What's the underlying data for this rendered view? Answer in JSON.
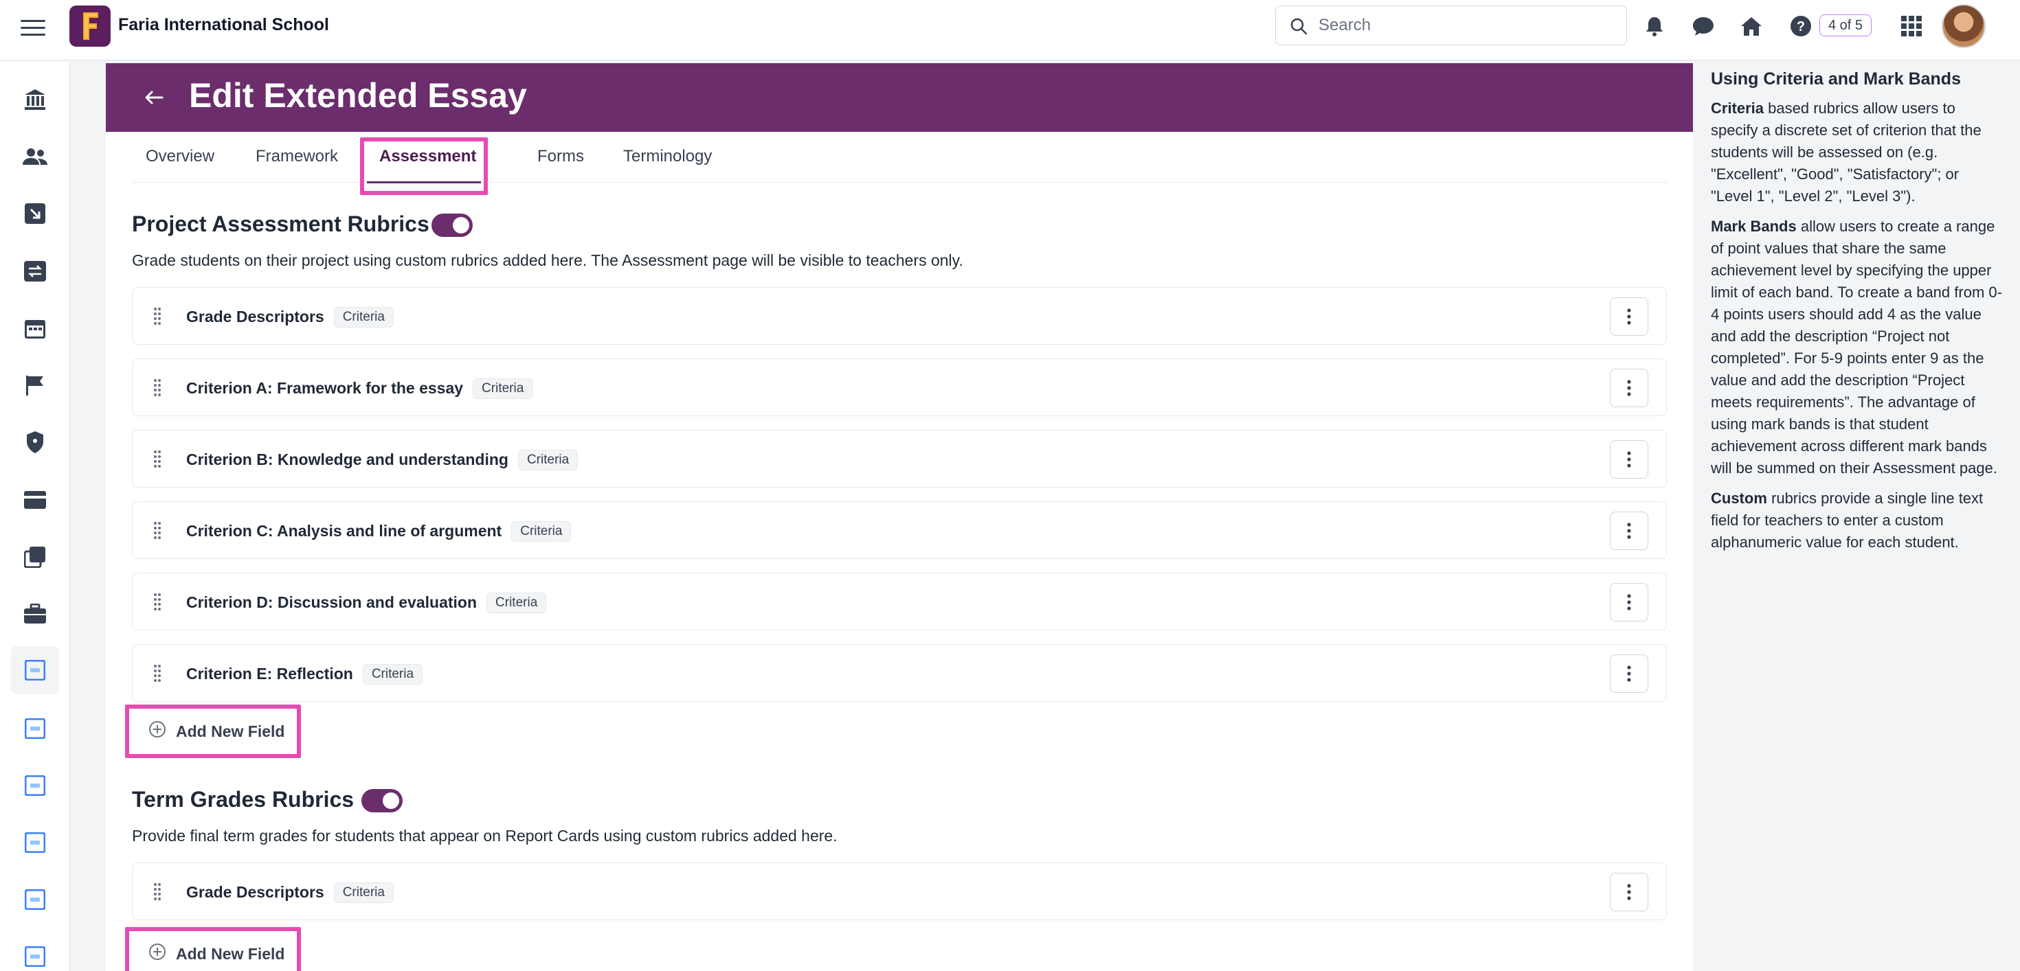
{
  "topbar": {
    "school_name": "Faria International School",
    "search_placeholder": "Search",
    "counter": "4 of 5"
  },
  "page": {
    "title": "Edit Extended Essay",
    "tabs": [
      "Overview",
      "Framework",
      "Assessment",
      "Forms",
      "Terminology"
    ],
    "active_tab": "Assessment"
  },
  "project_rubrics": {
    "title": "Project Assessment Rubrics",
    "description": "Grade students on their project using custom rubrics added here. The Assessment page will be visible to teachers only.",
    "fields": [
      {
        "label": "Grade Descriptors",
        "tag": "Criteria"
      },
      {
        "label": "Criterion A: Framework for the essay",
        "tag": "Criteria"
      },
      {
        "label": "Criterion B: Knowledge and understanding",
        "tag": "Criteria"
      },
      {
        "label": "Criterion C: Analysis and line of argument",
        "tag": "Criteria"
      },
      {
        "label": "Criterion D: Discussion and evaluation",
        "tag": "Criteria"
      },
      {
        "label": "Criterion E: Reflection",
        "tag": "Criteria"
      }
    ],
    "add_label": "Add New Field"
  },
  "term_rubrics": {
    "title": "Term Grades Rubrics",
    "description": "Provide final term grades for students that appear on Report Cards using custom rubrics added here.",
    "fields": [
      {
        "label": "Grade Descriptors",
        "tag": "Criteria"
      }
    ],
    "add_label": "Add New Field"
  },
  "help": {
    "title": "Using Criteria and Mark Bands",
    "criteria_term": "Criteria",
    "criteria_text": " based rubrics allow users to specify a discrete set of criterion that the students will be assessed on (e.g. \"Excellent\", \"Good\", \"Satisfactory\"; or \"Level 1\", \"Level 2\", \"Level 3\").",
    "markbands_term": "Mark Bands",
    "markbands_text": " allow users to create a range of point values that share the same achievement level by specifying the upper limit of each band. To create a band from 0-4 points users should add 4 as the value and add the description “Project not completed”. For 5-9 points enter 9 as the value and add the description “Project meets requirements”. The advantage of using mark bands is that student achievement across different mark bands will be summed on their Assessment page.",
    "custom_term": "Custom",
    "custom_text": " rubrics provide a single line text field for teachers to enter a custom alphanumeric value for each student."
  },
  "colors": {
    "brand": "#6b2d6c",
    "highlight": "#e64bb0"
  },
  "icons": {
    "rail": [
      "institution-icon",
      "people-icon",
      "import-icon",
      "transfer-icon",
      "calendar-icon",
      "flag-icon",
      "shield-icon",
      "card-icon",
      "copy-icon",
      "briefcase-icon",
      "form-icon",
      "form-icon",
      "form-icon",
      "form-icon",
      "form-icon",
      "form-icon"
    ]
  }
}
